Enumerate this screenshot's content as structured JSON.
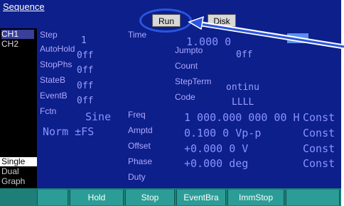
{
  "header": {
    "title": "Sequence",
    "run_label": "Run",
    "disk_label": "Disk"
  },
  "sidebar": {
    "items": [
      {
        "label": "CH1",
        "selected": true
      },
      {
        "label": "CH2",
        "selected": false
      }
    ],
    "bottom": [
      {
        "label": "Single",
        "selected": true
      },
      {
        "label": "Dual",
        "selected": false
      },
      {
        "label": "Graph",
        "selected": false
      }
    ]
  },
  "params_left": [
    {
      "label": "Step",
      "value": "1"
    },
    {
      "label": "AutoHold",
      "value": "0ff"
    },
    {
      "label": "StopPhs",
      "value": "0ff"
    },
    {
      "label": "StateB",
      "value": "0ff"
    },
    {
      "label": "EventB",
      "value": "0ff"
    },
    {
      "label": "Fctn",
      "value": "Sine"
    },
    {
      "label": "",
      "value": "Norm ±FS"
    }
  ],
  "params_right": {
    "time_label": "Time",
    "time_value": "1.000 0",
    "jumpto_label": "Jumpto",
    "jumpto_value": "0ff",
    "count_label": "Count",
    "stepterm_label": "StepTerm",
    "stepterm_value": "ontinu",
    "code_label": "Code",
    "code_value": "LLLL"
  },
  "waveform": {
    "freq_label": "Freq",
    "freq_value": "1 000.000 000 00 H",
    "freq_mode": "Const",
    "amptd_label": "Amptd",
    "amptd_value": "0.100 0 Vp-p",
    "amptd_mode": "Const",
    "offset_label": "Offset",
    "offset_value": "+0.000 0 V",
    "offset_mode": "Const",
    "phase_label": "Phase",
    "phase_value": "+0.000 deg",
    "phase_mode": "Const",
    "duty_label": "Duty"
  },
  "softkeys": [
    "",
    "Hold",
    "Stop",
    "EventBra",
    "ImmStop",
    ""
  ],
  "colors": {
    "panel_bg": "#0c1f8a",
    "annotation": "#2a55e0",
    "softkey_bg": "#2c9d96"
  }
}
